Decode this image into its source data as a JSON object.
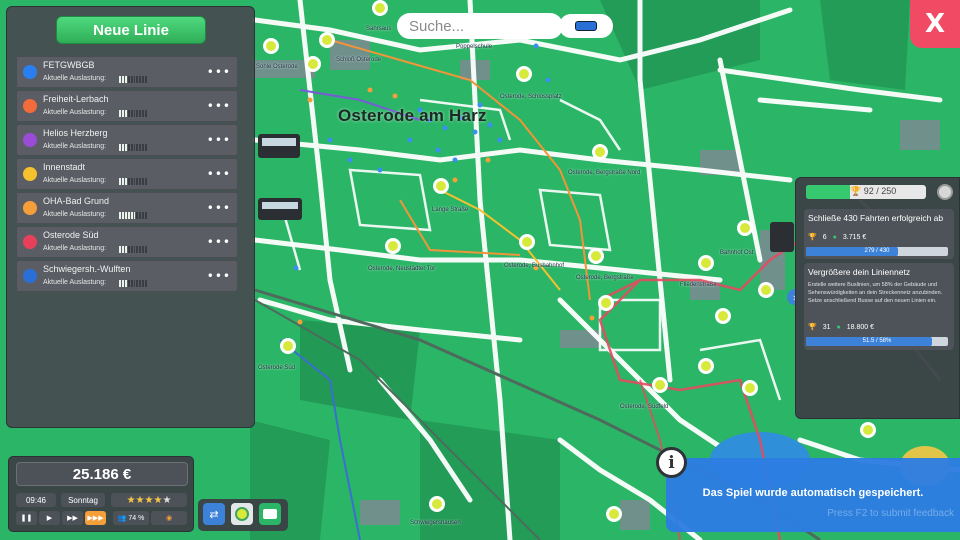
{
  "map": {
    "city_label": "Osterode am Harz",
    "stop_labels": [
      "Sahrsaus",
      "Bahnhof",
      "Sohle Osterode",
      "Schloß Osterode",
      "Poppelschule",
      "Osterode, Schlossplatz",
      "Osterode, Busbahnhof",
      "Osterode, Neustädter Tor",
      "Lange Straße",
      "Osterode, Bergstraße",
      "Bahnhof Ost",
      "Osterode, Südfeld",
      "Fliedenstraße",
      "Osterode, Bergstraße Nord",
      "Osterode Süd",
      "Schwiegershausen"
    ]
  },
  "search": {
    "placeholder": "Suche..."
  },
  "close_button": {
    "label": "X"
  },
  "lines_panel": {
    "new_line_label": "Neue Linie",
    "load_label": "Aktuelle Auslastung:",
    "lines": [
      {
        "name": "FETGWBGB",
        "color": "#2a7ff0",
        "load": 0.3
      },
      {
        "name": "Freiheit-Lerbach",
        "color": "#f26b3a",
        "load": 0.3
      },
      {
        "name": "Helios Herzberg",
        "color": "#9b4cd6",
        "load": 0.3
      },
      {
        "name": "Innenstadt",
        "color": "#f5c12e",
        "load": 0.3
      },
      {
        "name": "OHA-Bad Grund",
        "color": "#f59f3a",
        "load": 0.6
      },
      {
        "name": "Osterode Süd",
        "color": "#e8405a",
        "load": 0.3
      },
      {
        "name": "Schwiegersh.-Wulften",
        "color": "#2a6fd6",
        "load": 0.3
      }
    ]
  },
  "hud": {
    "money": "25.186 €",
    "time": "09:46",
    "day": "Sonntag",
    "rating_stars": 4,
    "rating_max": 5,
    "passengers": "74 %"
  },
  "goals": {
    "trophy_text": "92 / 250",
    "trophy_progress": 0.37,
    "cards": [
      {
        "title": "Schließe 430 Fahrten erfolgreich ab",
        "description": "",
        "trophies": "6",
        "money": "3.715 €",
        "progress_text": "279 / 430",
        "progress": 0.65
      },
      {
        "title": "Vergrößere dein Liniennetz",
        "description": "Erstelle weitere Buslinien, um 58% der Gebäude und Sehenswürdigkeiten an dein Streckennetz anzubinden. Setze anschließend Busse auf den neuen Linien ein.",
        "trophies": "31",
        "money": "18.800 €",
        "progress_text": "51.5 / 58%",
        "progress": 0.89
      }
    ]
  },
  "notification": {
    "message": "Das Spiel wurde automatisch gespeichert.",
    "subtext": "Press F2 to submit feedback"
  }
}
